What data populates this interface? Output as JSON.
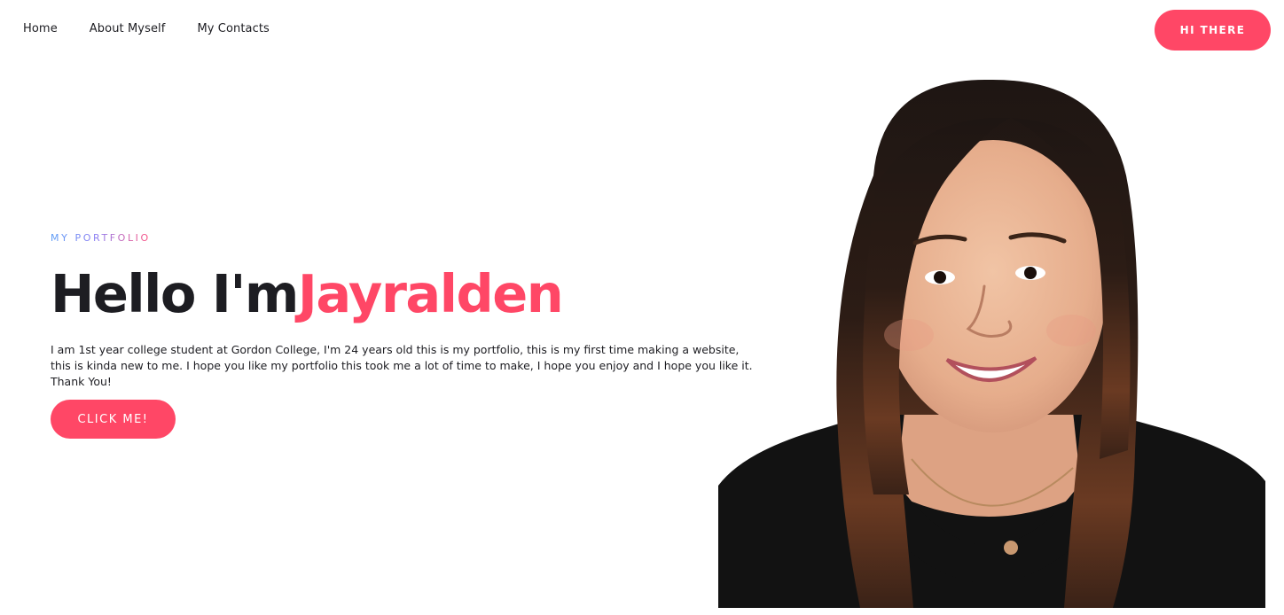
{
  "nav": {
    "items": [
      "Home",
      "About Myself",
      "My Contacts"
    ],
    "cta_label": "HI THERE"
  },
  "hero": {
    "eyebrow": "MY PORTFOLIO",
    "headline_prefix": "Hello I'm",
    "headline_name": "Jayralden",
    "bio": "I am 1st year college student at Gordon College, I'm 24 years old this is my portfolio, this is my first time making a website, this is kinda new to me. I hope you like my portfolio this took me a lot of time to make, I hope you enjoy and I hope you like it. Thank You!",
    "button_label": "CLICK ME!"
  },
  "colors": {
    "accent": "#ff4766",
    "text": "#1d1d22",
    "background": "#ffffff"
  },
  "portrait": {
    "icon": "profile-photo"
  }
}
